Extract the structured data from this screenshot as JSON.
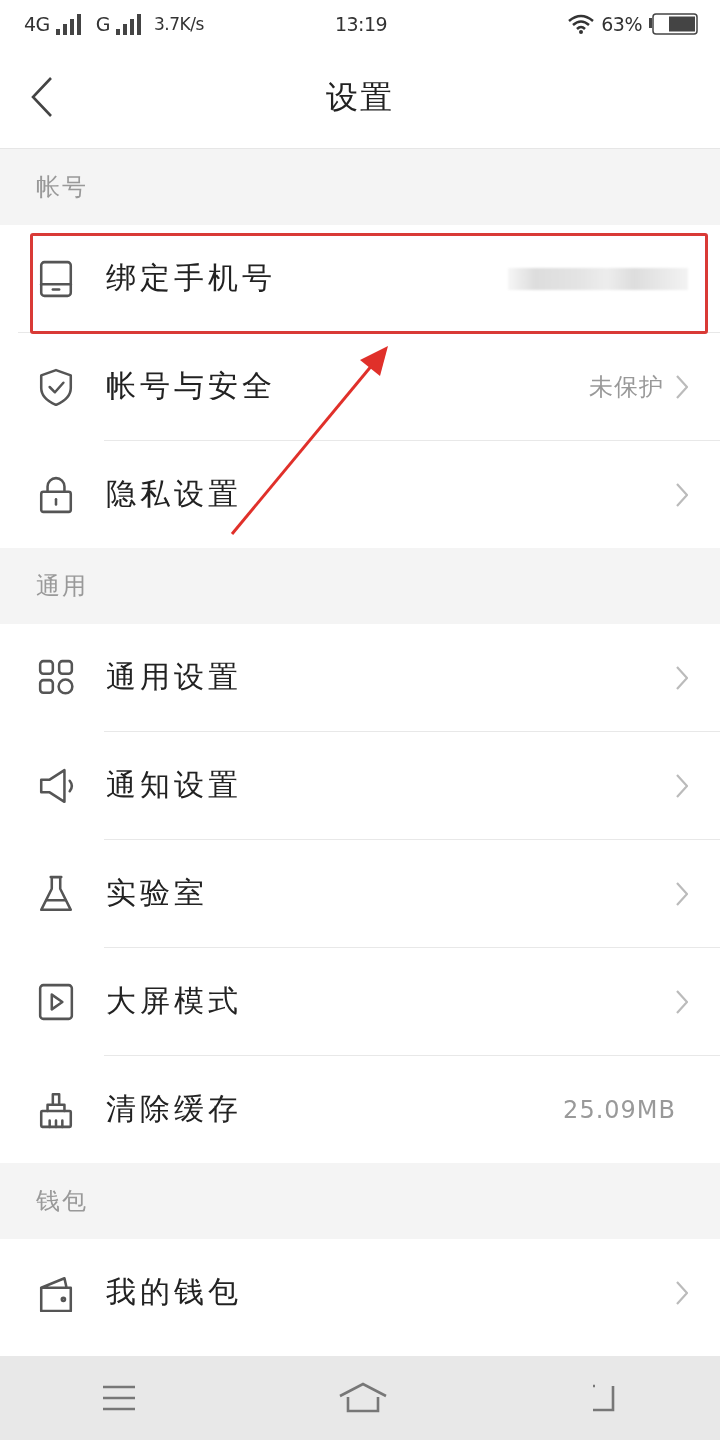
{
  "status_bar": {
    "network_1": "4G",
    "network_2": "G",
    "speed": "3.7K/s",
    "time": "13:19",
    "battery": "63%"
  },
  "header": {
    "title": "设置"
  },
  "sections": [
    {
      "title": "帐号",
      "items": [
        {
          "label": "绑定手机号",
          "masked": true,
          "chevron": false,
          "highlighted": true
        },
        {
          "label": "帐号与安全",
          "value": "未保护",
          "chevron": true,
          "highlighted": false
        },
        {
          "label": "隐私设置",
          "chevron": true,
          "highlighted": false
        }
      ]
    },
    {
      "title": "通用",
      "items": [
        {
          "label": "通用设置",
          "chevron": true,
          "highlighted": false
        },
        {
          "label": "通知设置",
          "chevron": true,
          "highlighted": false
        },
        {
          "label": "实验室",
          "chevron": true,
          "highlighted": false
        },
        {
          "label": "大屏模式",
          "chevron": true,
          "highlighted": false
        },
        {
          "label": "清除缓存",
          "value": "25.09MB",
          "chevron": false,
          "highlighted": false
        }
      ]
    },
    {
      "title": "钱包",
      "items": [
        {
          "label": "我的钱包",
          "chevron": true,
          "highlighted": false
        }
      ]
    }
  ]
}
